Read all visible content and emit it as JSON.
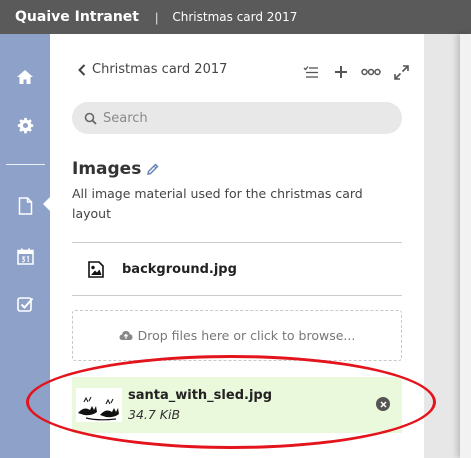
{
  "topbar": {
    "brand": "Quaive Intranet",
    "separator": "|",
    "context": "Christmas card 2017"
  },
  "panel": {
    "back_label": "Christmas card 2017",
    "search": {
      "placeholder": "Search",
      "value": ""
    },
    "folder": {
      "title": "Images",
      "description": "All image material used for the christmas card layout"
    },
    "files": [
      {
        "name": "background.jpg",
        "icon": "image-file-icon"
      }
    ],
    "dropzone_label": "Drop files here or click to browse...",
    "upload": {
      "name": "santa_with_sled.jpg",
      "size": "34.7 KiB"
    }
  },
  "colors": {
    "topbar": "#5a5a5a",
    "sidebar": "#8da1c9",
    "upload_bg": "#eaf8dc",
    "annotation": "#e3141c"
  },
  "icons": {
    "sidebar": [
      "home-icon",
      "gear-icon",
      "document-icon",
      "calendar-icon",
      "checkbox-icon"
    ],
    "toolbar": [
      "checklist-icon",
      "plus-icon",
      "more-icon",
      "fullscreen-icon"
    ]
  }
}
